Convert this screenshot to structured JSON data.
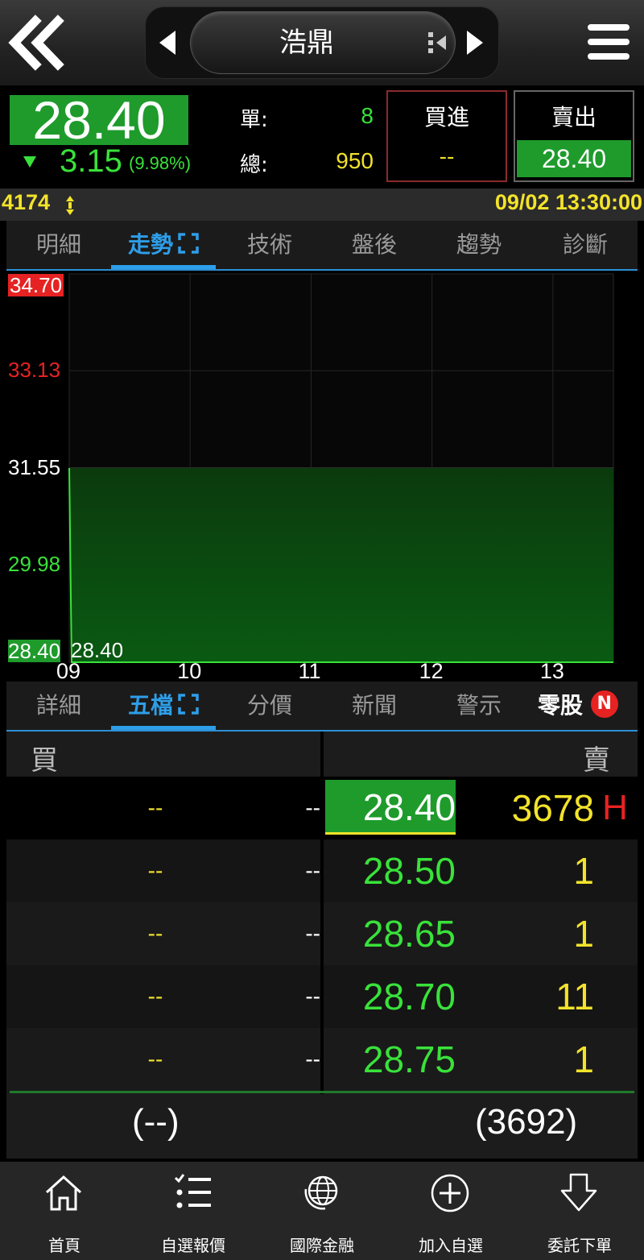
{
  "header": {
    "stock_name": "浩鼎",
    "icons": [
      "double-chevron-left-icon",
      "caret-left-icon",
      "caret-right-icon",
      "switch-icon",
      "hamburger-menu-icon"
    ]
  },
  "quote": {
    "price": "28.40",
    "change": "3.15",
    "change_pct": "(9.98%)",
    "single_label": "單:",
    "single_value": "8",
    "total_label": "總:",
    "total_value": "950",
    "buy_label": "買進",
    "buy_value": "--",
    "sell_label": "賣出",
    "sell_value": "28.40"
  },
  "infobar": {
    "code": "4174",
    "datetime": "09/02 13:30:00"
  },
  "main_tabs": [
    {
      "label": "明細"
    },
    {
      "label": "走勢"
    },
    {
      "label": "技術"
    },
    {
      "label": "盤後"
    },
    {
      "label": "趨勢"
    },
    {
      "label": "診斷"
    }
  ],
  "main_tabs_active": 1,
  "chart_data": {
    "type": "area",
    "y_ticks": [
      "34.70",
      "33.13",
      "31.55",
      "29.98",
      "28.40"
    ],
    "x_ticks": [
      "09",
      "10",
      "11",
      "12",
      "13"
    ],
    "ylim": [
      28.4,
      34.7
    ],
    "reference_price": 31.55,
    "last_label": "28.40",
    "series": [
      {
        "x": [
          9.0,
          9.02,
          13.5
        ],
        "values": [
          31.55,
          28.4,
          28.4
        ]
      }
    ],
    "colors": {
      "up": "#e62222",
      "down": "#39e23a",
      "ref": "#ffffff",
      "fill": "#0a3a0c"
    }
  },
  "sub_tabs": [
    {
      "label": "詳細"
    },
    {
      "label": "五檔"
    },
    {
      "label": "分價"
    },
    {
      "label": "新聞"
    },
    {
      "label": "警示"
    },
    {
      "label": "零股"
    }
  ],
  "sub_tabs_active": 1,
  "odd_lot_badge": "N",
  "order_book": {
    "buy_header": "買",
    "sell_header": "賣",
    "rows": [
      {
        "bid_qty": "--",
        "bid_price": "--",
        "ask_price": "28.40",
        "ask_qty": "3678",
        "mark": "H"
      },
      {
        "bid_qty": "--",
        "bid_price": "--",
        "ask_price": "28.50",
        "ask_qty": "1",
        "mark": ""
      },
      {
        "bid_qty": "--",
        "bid_price": "--",
        "ask_price": "28.65",
        "ask_qty": "1",
        "mark": ""
      },
      {
        "bid_qty": "--",
        "bid_price": "--",
        "ask_price": "28.70",
        "ask_qty": "11",
        "mark": ""
      },
      {
        "bid_qty": "--",
        "bid_price": "--",
        "ask_price": "28.75",
        "ask_qty": "1",
        "mark": ""
      }
    ],
    "bid_total": "(--)",
    "ask_total": "(3692)"
  },
  "bottom_nav": [
    {
      "label": "首頁",
      "icon": "home-icon"
    },
    {
      "label": "自選報價",
      "icon": "list-icon"
    },
    {
      "label": "國際金融",
      "icon": "globe-icon"
    },
    {
      "label": "加入自選",
      "icon": "add-circle-icon"
    },
    {
      "label": "委託下單",
      "icon": "order-down-icon"
    }
  ]
}
